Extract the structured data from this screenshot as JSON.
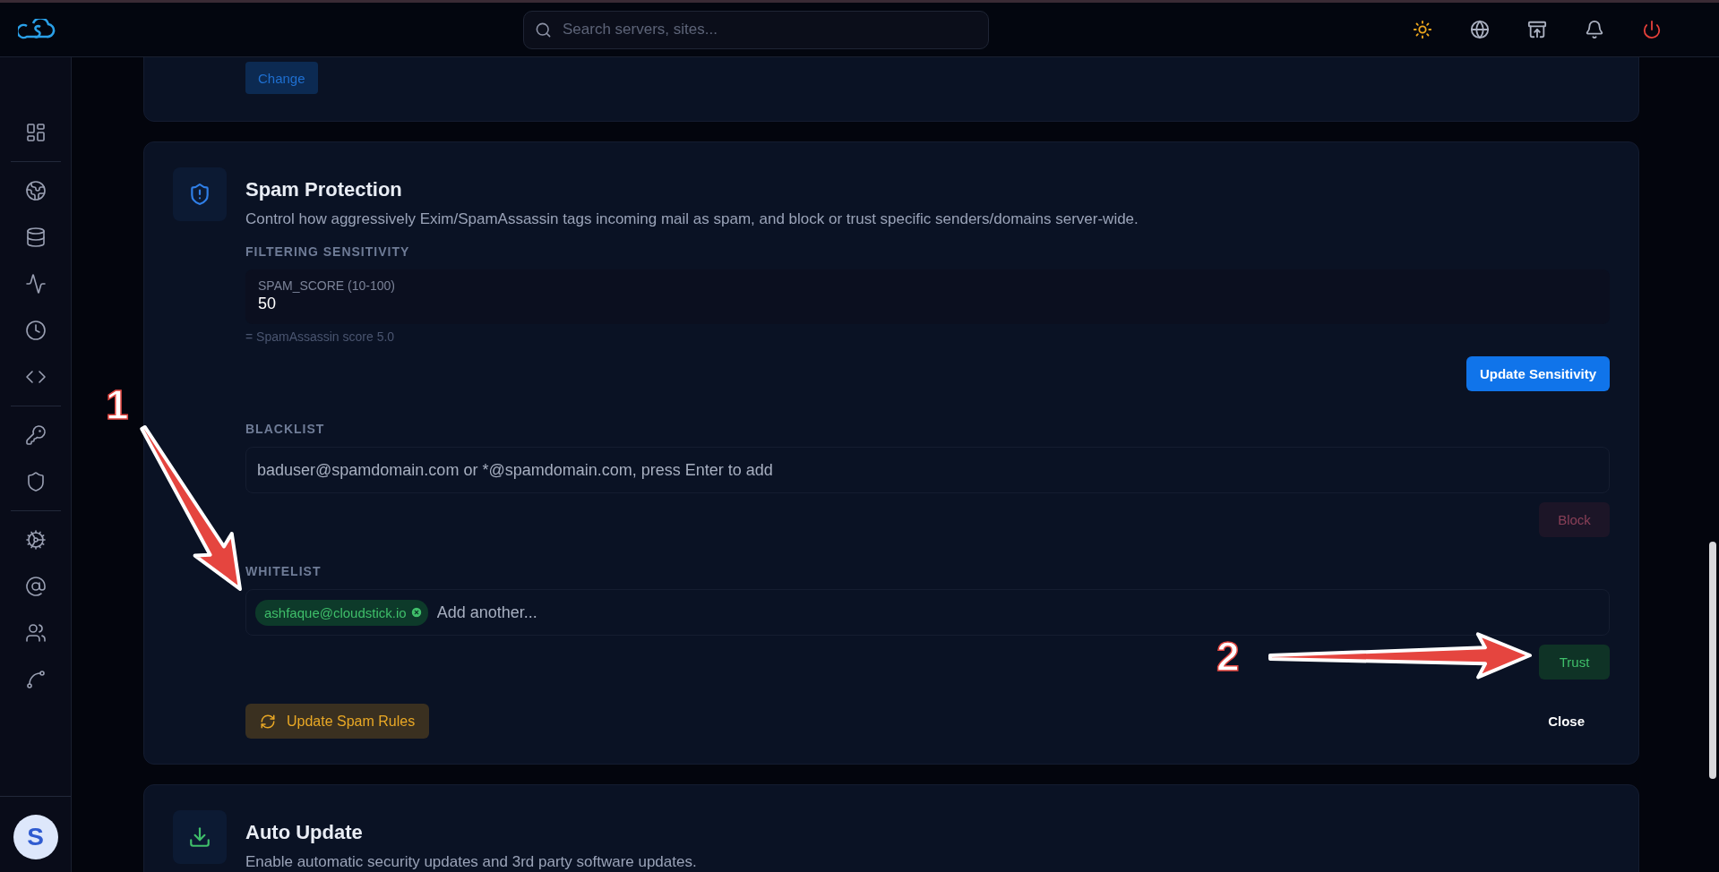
{
  "header": {
    "search": {
      "placeholder": "Search servers, sites..."
    }
  },
  "sidebar": {
    "avatar": "S"
  },
  "previous_card": {
    "button": "Change"
  },
  "spam_protection": {
    "title": "Spam Protection",
    "description": "Control how aggressively Exim/SpamAssassin tags incoming mail as spam, and block or trust specific senders/domains server-wide.",
    "sensitivity": {
      "heading": "FILTERING SENSITIVITY",
      "field_label": "SPAM_SCORE (10-100)",
      "value": "50",
      "hint": "= SpamAssassin score 5.0",
      "button": "Update Sensitivity"
    },
    "blacklist": {
      "heading": "BLACKLIST",
      "placeholder": "baduser@spamdomain.com or *@spamdomain.com, press Enter to add",
      "button": {
        "label": "Block",
        "disabled": true
      }
    },
    "whitelist": {
      "heading": "WHITELIST",
      "placeholder": "Add another...",
      "tags": [
        {
          "label": "ashfaque@cloudstick.io"
        }
      ],
      "button": {
        "label": "Trust",
        "disabled": false
      }
    },
    "update_button": "Update Spam Rules",
    "close_button": "Close"
  },
  "auto_update": {
    "title": "Auto Update",
    "description": "Enable automatic security updates and 3rd party software updates."
  },
  "annotations": [
    {
      "number": "1"
    },
    {
      "number": "2"
    }
  ]
}
